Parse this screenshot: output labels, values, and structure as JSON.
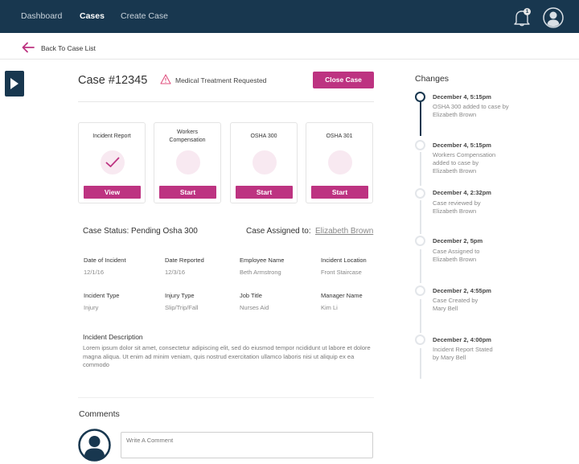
{
  "nav": {
    "items": [
      {
        "label": "Dashboard",
        "active": false
      },
      {
        "label": "Cases",
        "active": true
      },
      {
        "label": "Create Case",
        "active": false
      }
    ],
    "notification_count": "1",
    "icons": {
      "notifications": "bell-icon",
      "profile": "user-avatar-icon"
    }
  },
  "back": {
    "label": "Back To Case List",
    "icon": "arrow-left-icon"
  },
  "sidebar_toggle": {
    "icon": "caret-right-icon"
  },
  "case": {
    "title": "Case #12345",
    "alert": {
      "icon": "warning-triangle-icon",
      "text": "Medical Treatment Requested"
    },
    "close_button": "Close Case"
  },
  "forms": [
    {
      "title": "Incident Report",
      "completed": true,
      "button": "View",
      "icon": "check-icon"
    },
    {
      "title": "Workers\nCompensation",
      "completed": false,
      "button": "Start"
    },
    {
      "title": "OSHA 300",
      "completed": false,
      "button": "Start"
    },
    {
      "title": "OSHA 301",
      "completed": false,
      "button": "Start"
    }
  ],
  "status": {
    "text": "Case Status: Pending Osha 300",
    "assigned_label": "Case Assigned to:",
    "assigned_to": "Elizabeth Brown"
  },
  "fields": [
    {
      "label": "Date of Incident",
      "value": "12/1/16"
    },
    {
      "label": "Date Reported",
      "value": "12/3/16"
    },
    {
      "label": "Employee Name",
      "value": "Beth Armstrong"
    },
    {
      "label": "Incident Location",
      "value": "Front Staircase"
    },
    {
      "label": "Incident Type",
      "value": "Injury"
    },
    {
      "label": "Injury Type",
      "value": "Slip/Trip/Fall"
    },
    {
      "label": "Job Title",
      "value": "Nurses Aid"
    },
    {
      "label": "Manager Name",
      "value": "Kim Li"
    }
  ],
  "description": {
    "label": "Incident Description",
    "text": "Lorem ipsum dolor sit amet, consectetur adipiscing elit, sed do eiusmod tempor ncididunt ut labore et dolore magna aliqua. Ut enim ad minim veniam, quis nostrud exercitation ullamco laboris nisi ut aliquip ex ea commodo"
  },
  "comments": {
    "title": "Comments",
    "placeholder": "Write A Comment",
    "value": ""
  },
  "changes": {
    "title": "Changes",
    "items": [
      {
        "date": "December 4, 5:15pm",
        "text": "OSHA 300 added to case by Elizabeth Brown",
        "active": true
      },
      {
        "date": "December 4, 5:15pm",
        "text": "Workers Compensation added to case by Elizabeth Brown",
        "active": false
      },
      {
        "date": "December 4, 2:32pm",
        "text": "Case reviewed by Elizabeth Brown",
        "active": false
      },
      {
        "date": "December 2, 5pm",
        "text": "Case Assigned to Elizabeth Brown",
        "active": false
      },
      {
        "date": "December 2, 4:55pm",
        "text": "Case Created by Mary Bell",
        "active": false
      },
      {
        "date": "December 2, 4:00pm",
        "text": "Incident Report Stated by  Mary Bell",
        "active": false
      }
    ]
  },
  "colors": {
    "nav_bg": "#18374f",
    "accent": "#bd3381",
    "accent_light": "#f8e9f1",
    "warning": "#e0507f"
  }
}
